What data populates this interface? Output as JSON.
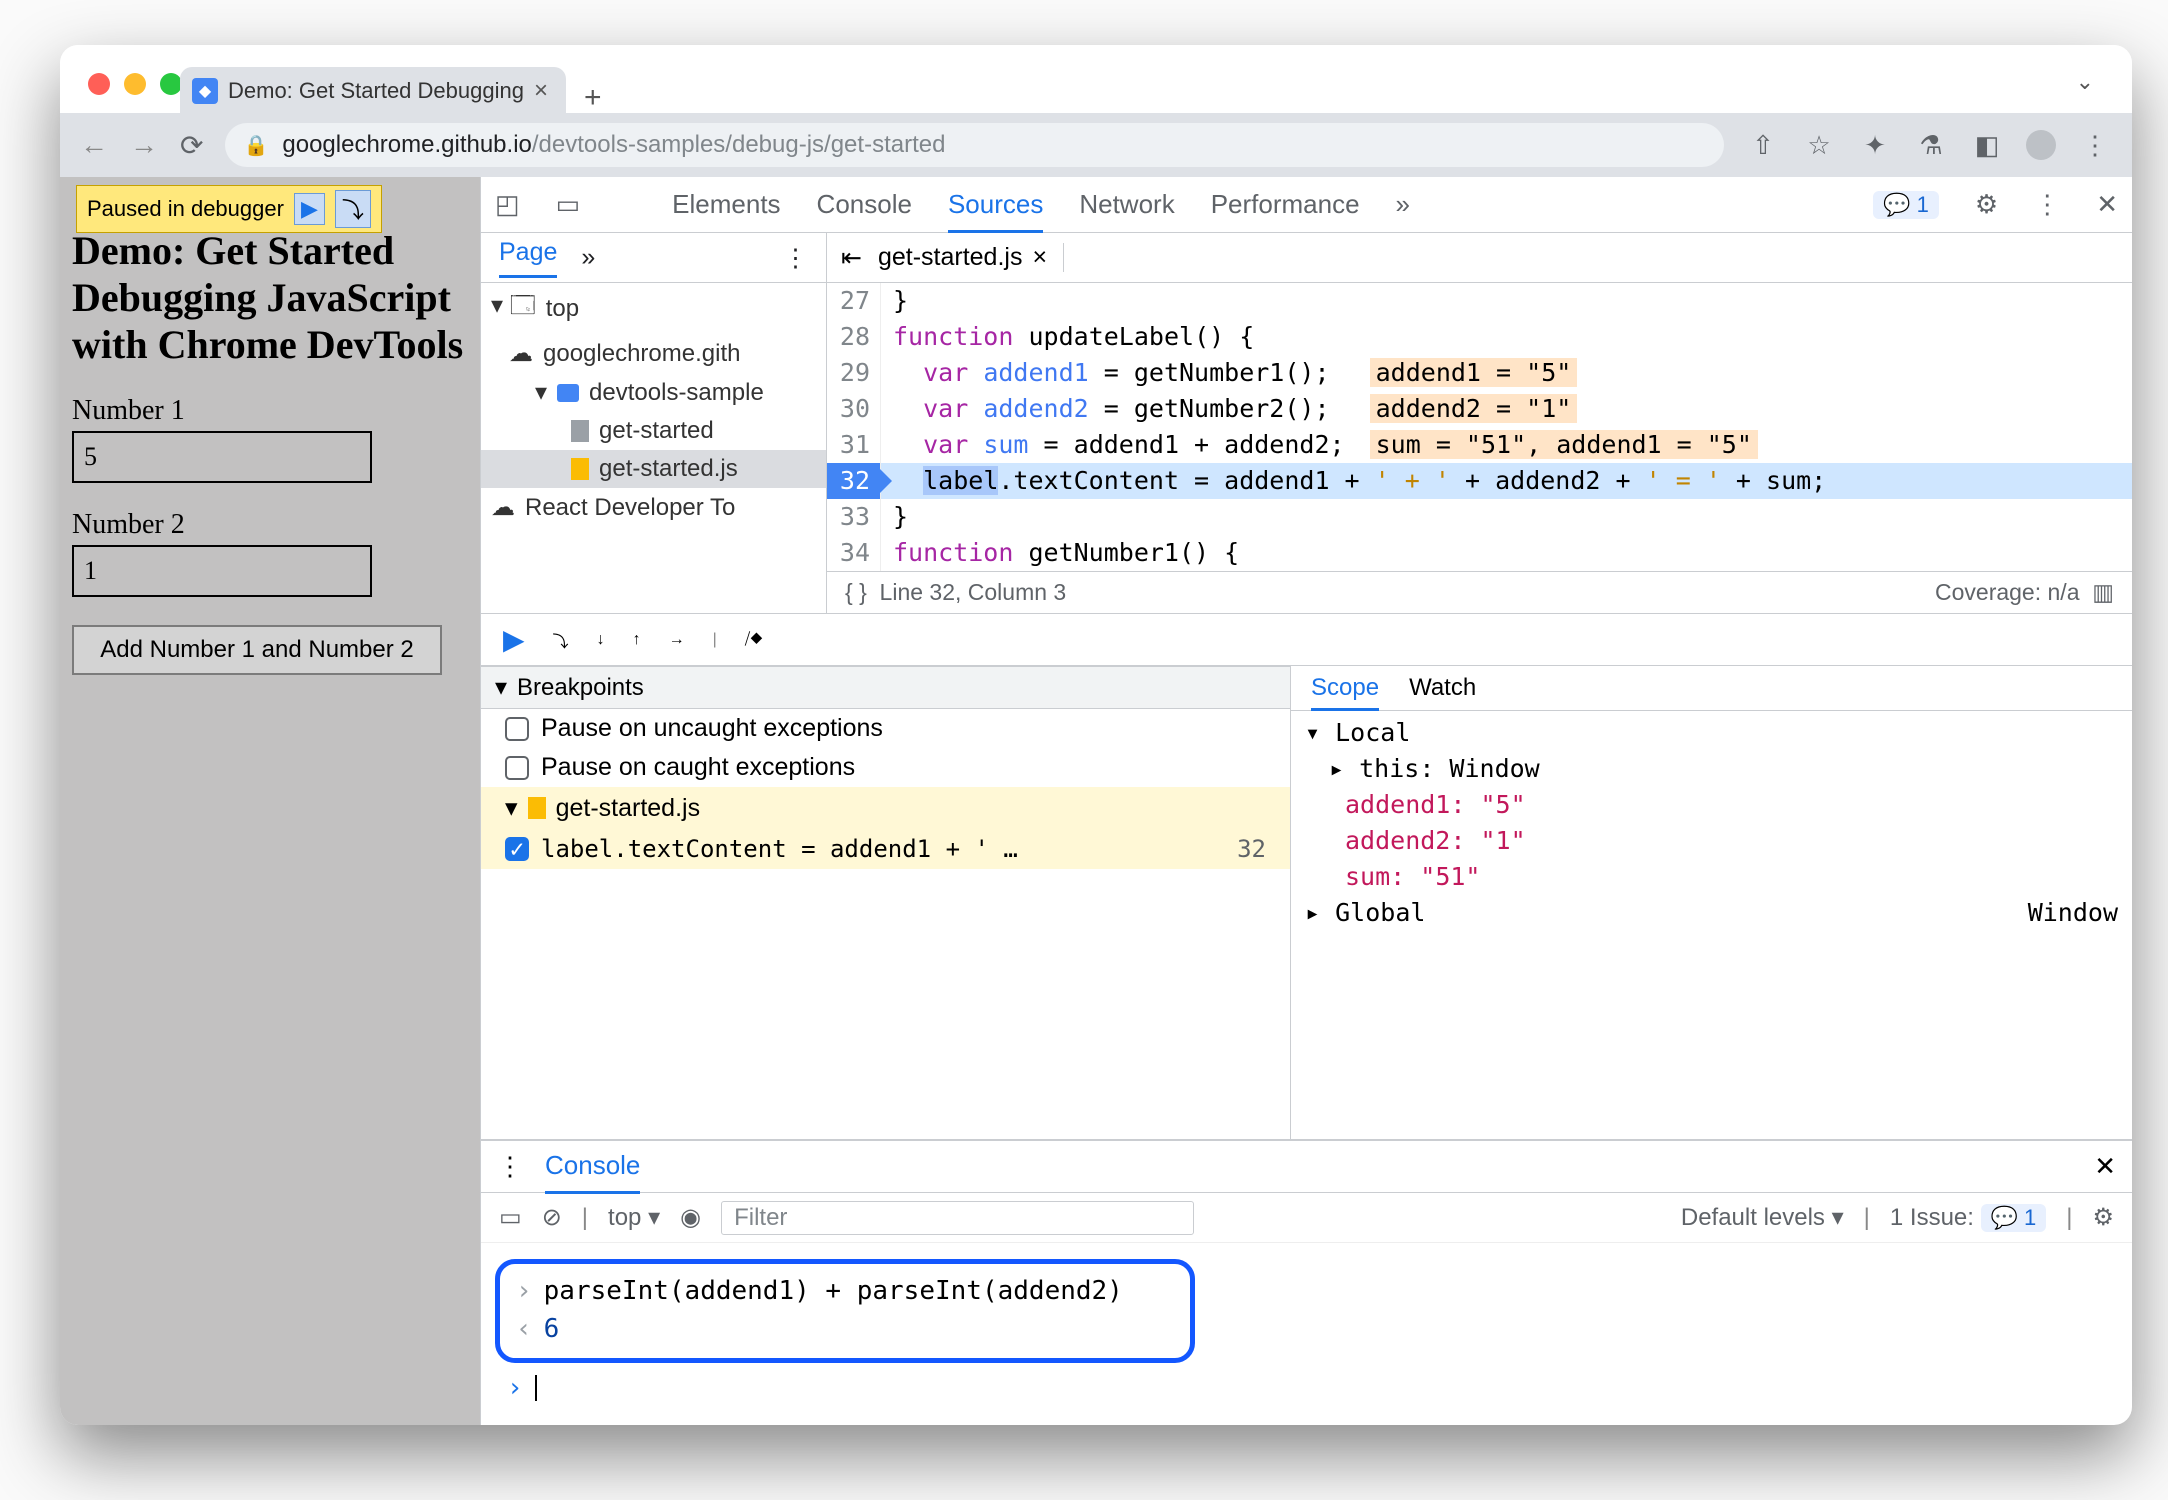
{
  "browser": {
    "tab_title": "Demo: Get Started Debugging",
    "url_host": "googlechrome.github.io",
    "url_path": "/devtools-samples/debug-js/get-started"
  },
  "page": {
    "pause_badge": "Paused in debugger",
    "title_lines": "Demo: Get Started Debugging JavaScript with Chrome DevTools",
    "label1": "Number 1",
    "value1": "5",
    "label2": "Number 2",
    "value2": "1",
    "button": "Add Number 1 and Number 2"
  },
  "devtools": {
    "tabs": {
      "elements": "Elements",
      "console": "Console",
      "sources": "Sources",
      "network": "Network",
      "performance": "Performance",
      "more": "»",
      "issues": "1"
    },
    "nav": {
      "page": "Page",
      "more": "»",
      "top": "top",
      "host": "googlechrome.gith",
      "folder": "devtools-sample",
      "f1": "get-started",
      "f2": "get-started.js",
      "react": "React Developer To"
    },
    "file_tab": "get-started.js",
    "code": {
      "27": "}",
      "28": "function updateLabel() {",
      "29_a": "  var addend1 = getNumber1();",
      "29_b": "addend1 = \"5\"",
      "30_a": "  var addend2 = getNumber2();",
      "30_b": "addend2 = \"1\"",
      "31_a": "  var sum = addend1 + addend2;",
      "31_b": "sum = \"51\", addend1 = \"5\"",
      "32": "  label.textContent = addend1 + ' + ' + addend2 + ' = ' + sum;",
      "33": "}",
      "34": "function getNumber1() {"
    },
    "status": {
      "pos": "Line 32, Column 3",
      "coverage": "Coverage: n/a",
      "braces": "{ }"
    },
    "breakpoints": {
      "title": "Breakpoints",
      "uncaught": "Pause on uncaught exceptions",
      "caught": "Pause on caught exceptions",
      "file": "get-started.js",
      "bptext": "label.textContent = addend1 + ' …",
      "bpln": "32"
    },
    "scope": {
      "tabs": {
        "scope": "Scope",
        "watch": "Watch"
      },
      "local": "Local",
      "this": "this: ",
      "thisval": "Window",
      "a1k": "addend1: ",
      "a1v": "\"5\"",
      "a2k": "addend2: ",
      "a2v": "\"1\"",
      "sk": "sum: ",
      "sv": "\"51\"",
      "global": "Global",
      "globalv": "Window"
    },
    "console": {
      "title": "Console",
      "top": "top",
      "filter": "Filter",
      "levels": "Default levels",
      "issues_lbl": "1 Issue:",
      "issues_n": "1",
      "expr": "parseInt(addend1) + parseInt(addend2)",
      "result": "6"
    }
  }
}
